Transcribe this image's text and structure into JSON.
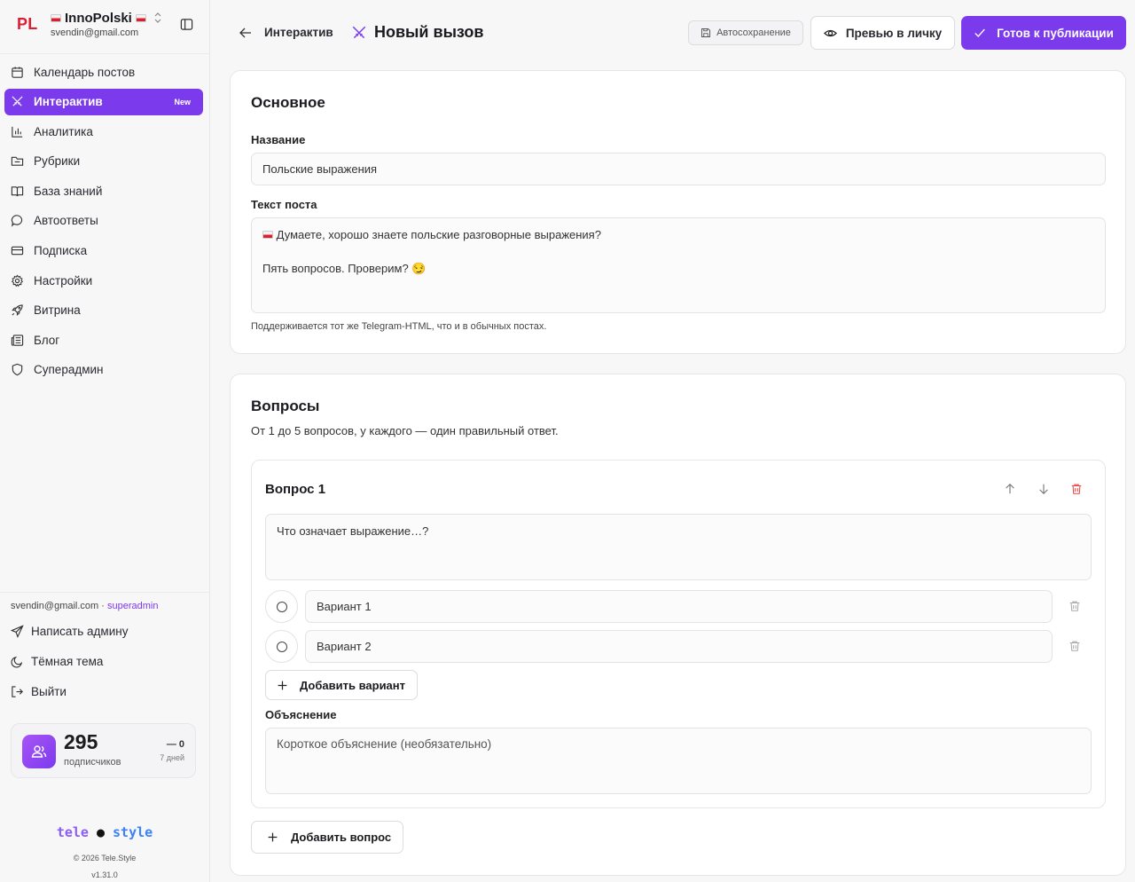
{
  "sidebar": {
    "brand_logo": "PL",
    "channel_name": "InnoPolski",
    "email": "svendin@gmail.com",
    "items": [
      {
        "label": "Календарь постов",
        "icon": "calendar-icon"
      },
      {
        "label": "Интерактив",
        "icon": "swords-icon",
        "badge": "New",
        "active": true
      },
      {
        "label": "Аналитика",
        "icon": "bar-chart-icon"
      },
      {
        "label": "Рубрики",
        "icon": "folder-icon"
      },
      {
        "label": "База знаний",
        "icon": "book-icon"
      },
      {
        "label": "Автоответы",
        "icon": "message-icon"
      },
      {
        "label": "Подписка",
        "icon": "credit-card-icon"
      },
      {
        "label": "Настройки",
        "icon": "gear-icon"
      },
      {
        "label": "Витрина",
        "icon": "rocket-icon"
      },
      {
        "label": "Блог",
        "icon": "newspaper-icon"
      },
      {
        "label": "Суперадмин",
        "icon": "shield-icon"
      }
    ],
    "footer": {
      "user_email": "svendin@gmail.com",
      "separator": " · ",
      "user_role": "superadmin",
      "write_admin": "Написать админу",
      "dark_theme": "Тёмная тема",
      "logout": "Выйти"
    },
    "subscribers": {
      "count": "295",
      "label": "подписчиков",
      "delta": "— 0",
      "period": "7 дней"
    },
    "logo": {
      "part1": "tele",
      "dot": " ● ",
      "part2": "style"
    },
    "copyright": "© 2026 Tele.Style",
    "version": "v1.31.0"
  },
  "header": {
    "breadcrumb": "Интерактив",
    "title": "Новый вызов",
    "autosave": "Автосохранение",
    "preview": "Превью в личку",
    "publish": "Готов к публикации"
  },
  "basic": {
    "heading": "Основное",
    "name_label": "Название",
    "name_value": "Польские выражения",
    "text_label": "Текст поста",
    "text_line1": "Думаете, хорошо знаете польские разговорные выражения?",
    "text_line2": "Пять вопросов. Проверим? 😏",
    "hint": "Поддерживается тот же Telegram-HTML, что и в обычных постах."
  },
  "questions": {
    "heading": "Вопросы",
    "subtitle": "От 1 до 5 вопросов, у каждого — один правильный ответ.",
    "items": [
      {
        "title": "Вопрос 1",
        "placeholder": "Что означает выражение…?",
        "options": [
          {
            "placeholder": "Вариант 1"
          },
          {
            "placeholder": "Вариант 2"
          }
        ],
        "add_option": "Добавить вариант",
        "explanation_label": "Объяснение",
        "explanation_placeholder": "Короткое объяснение (необязательно)"
      }
    ],
    "add_question": "Добавить вопрос"
  },
  "colors": {
    "accent": "#7c3aed",
    "brand_red": "#d92033",
    "danger": "#ef4444"
  }
}
